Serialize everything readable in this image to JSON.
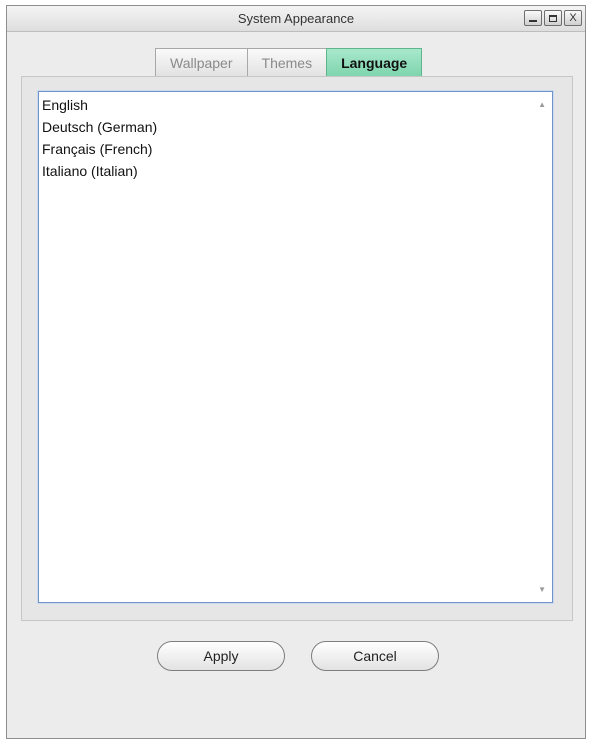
{
  "window": {
    "title": "System Appearance"
  },
  "controls": {
    "minimize_icon": "minimize-icon",
    "maximize_icon": "maximize-icon",
    "close_glyph": "X"
  },
  "tabs": [
    {
      "label": "Wallpaper",
      "active": false
    },
    {
      "label": "Themes",
      "active": false
    },
    {
      "label": "Language",
      "active": true
    }
  ],
  "languages": [
    "English",
    "Deutsch (German)",
    "Français (French)",
    "Italiano (Italian)"
  ],
  "buttons": {
    "apply": "Apply",
    "cancel": "Cancel"
  },
  "colors": {
    "active_tab": "#8fdcb9",
    "list_border": "#6f94c8"
  }
}
